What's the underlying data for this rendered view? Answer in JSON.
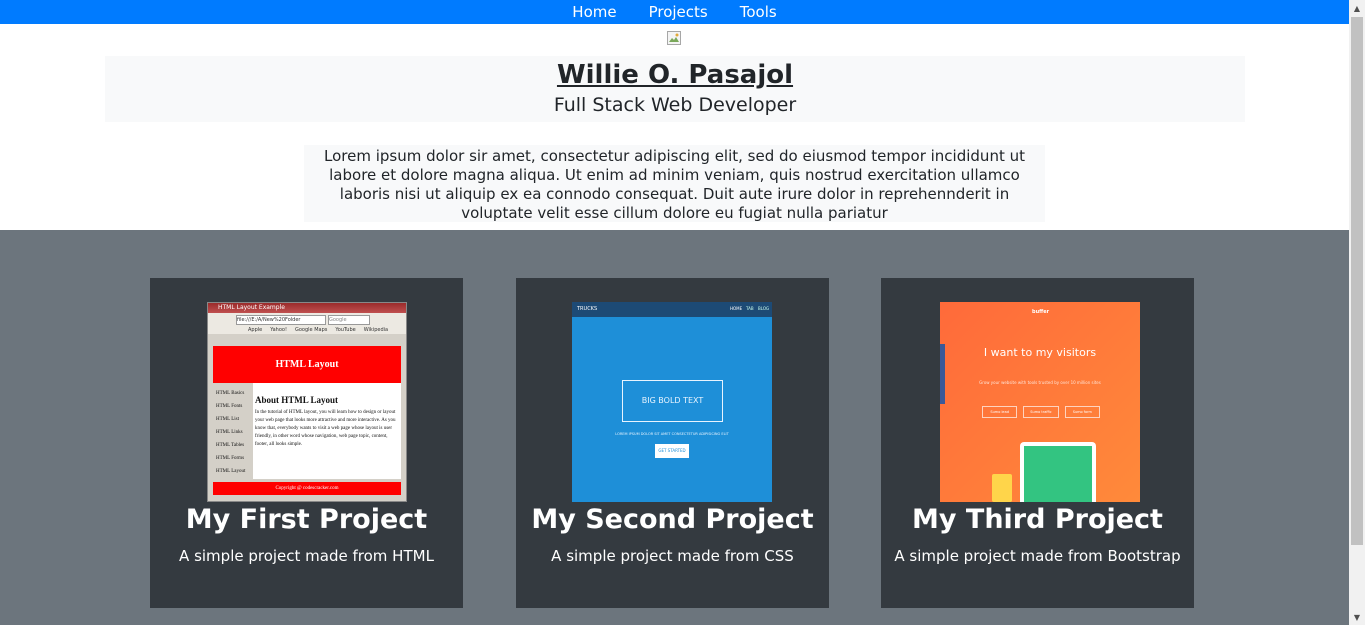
{
  "nav": {
    "items": [
      "Home",
      "Projects",
      "Tools"
    ]
  },
  "header": {
    "name": "Willie O. Pasajol",
    "title": "Full Stack Web Developer"
  },
  "intro": "Lorem ipsum dolor sir amet, consectetur adipiscing elit, sed do eiusmod tempor incididunt ut labore et dolore magna aliqua. Ut enim ad minim veniam, quis nostrud exercitation ullamco laboris nisi ut aliquip ex ea connodo consequat. Duit aute irure dolor in reprehennderit in voluptate velit esse cillum dolore eu fugiat nulla pariatur",
  "projects": [
    {
      "title": "My First Project",
      "description": "A simple project made from HTML",
      "thumb": {
        "window_title": "HTML Layout Example",
        "address": "file:///E:/A/New%20Folder",
        "search": "Google",
        "bookmarks": [
          "Apple",
          "Yahoo!",
          "Google Maps",
          "YouTube",
          "Wikipedia"
        ],
        "banner": "HTML Layout",
        "sidebar": [
          "HTML Basics",
          "HTML Fonts",
          "HTML List",
          "HTML Links",
          "HTML Tables",
          "HTML Forms",
          "HTML Layout"
        ],
        "heading": "About HTML Layout",
        "body": "In the tutorial of HTML layout, you will learn how to design or layout your web page that looks more attractive and more interactive. As you know that, everybody wants to visit a web page whose layout is user friendly, in other word whose navigation, web page topic, content, footer, all looks simple.",
        "footer": "Copyright @ codescracker.com"
      }
    },
    {
      "title": "My Second Project",
      "description": "A simple project made from CSS",
      "thumb": {
        "brand": "TRUCKS",
        "links": [
          "HOME",
          "TAB",
          "BLOG"
        ],
        "hero": "BIG BOLD TEXT",
        "tagline": "LOREM IPSUM DOLOR SIT AMET CONSECTETUR ADIPISICING ELIT",
        "cta": "GET STARTED"
      }
    },
    {
      "title": "My Third Project",
      "description": "A simple project made from Bootstrap",
      "thumb": {
        "brand": "buffer",
        "headline": "I want to  my visitors",
        "sub": "Grow your website with tools trusted by over 10 million sites",
        "buttons": [
          "Sumo lead",
          "Sumo traffic",
          "Sumo form"
        ]
      }
    }
  ],
  "colors": {
    "navbar": "#007bff",
    "section": "#6c757d",
    "card": "#343a40",
    "light": "#f8f9fa"
  }
}
